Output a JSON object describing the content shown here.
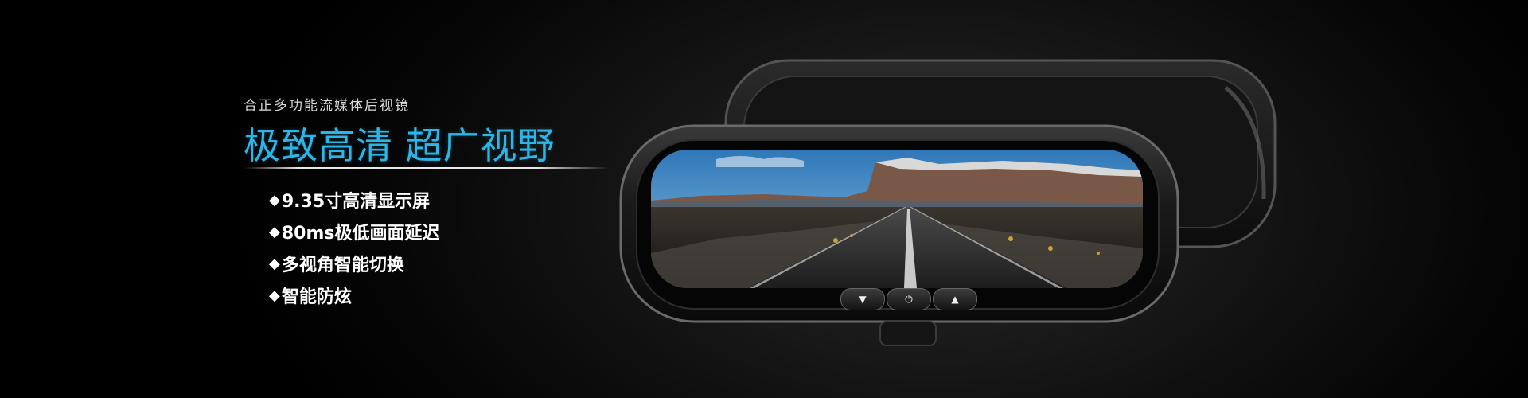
{
  "banner": {
    "subtitle": "合正多功能流媒体后视镜",
    "headline": "极致高清 超广视野",
    "features": [
      {
        "bullet": "◆",
        "label": "9.35寸高清显示屏"
      },
      {
        "bullet": "◆",
        "label": "80ms极低画面延迟"
      },
      {
        "bullet": "◆",
        "label": "多视角智能切换"
      },
      {
        "bullet": "◆",
        "label": "智能防炫"
      }
    ]
  },
  "mirror": {
    "buttons": [
      {
        "icon": "down-triangle-icon",
        "glyph": "▼"
      },
      {
        "icon": "power-icon",
        "glyph": "⏻"
      },
      {
        "icon": "up-triangle-icon",
        "glyph": "▲"
      }
    ]
  },
  "colors": {
    "accent": "#2cb6e8",
    "background": "#000000",
    "text": "#ffffff"
  }
}
